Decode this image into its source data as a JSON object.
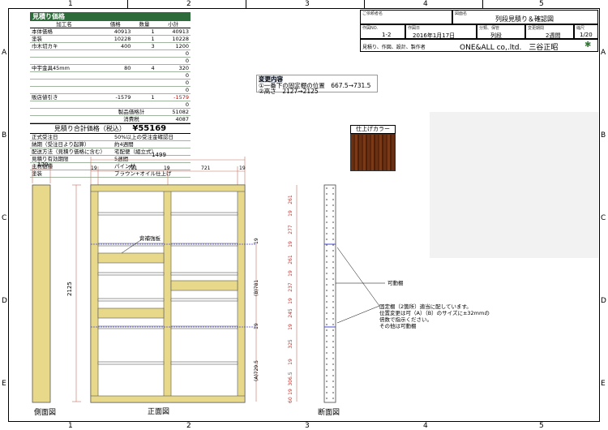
{
  "ruler": {
    "cols": [
      "1",
      "2",
      "3",
      "4",
      "5"
    ],
    "rows": [
      "A",
      "B",
      "C",
      "D",
      "E"
    ]
  },
  "estimate": {
    "title": "見積り価格",
    "headers": [
      "加工名",
      "価格",
      "数量",
      "小計"
    ],
    "rows": [
      {
        "name": "本体価格",
        "price": "40913",
        "qty": "1",
        "sub": "40913"
      },
      {
        "name": "塗装",
        "price": "10228",
        "qty": "1",
        "sub": "10228"
      },
      {
        "name": "巾木切カキ",
        "price": "400",
        "qty": "3",
        "sub": "1200"
      },
      {
        "name": "",
        "price": "",
        "qty": "",
        "sub": "0"
      },
      {
        "name": "",
        "price": "",
        "qty": "",
        "sub": "0"
      },
      {
        "name": "中宇金具45mm",
        "price": "80",
        "qty": "4",
        "sub": "320"
      },
      {
        "name": "",
        "price": "",
        "qty": "",
        "sub": "0"
      },
      {
        "name": "",
        "price": "",
        "qty": "",
        "sub": "0"
      },
      {
        "name": "",
        "price": "",
        "qty": "",
        "sub": "0"
      },
      {
        "name": "販店値引き",
        "price": "-1579",
        "qty": "1",
        "sub": "-1579"
      },
      {
        "name": "",
        "price": "",
        "qty": "",
        "sub": "0"
      }
    ],
    "product_total_label": "製品価格計",
    "product_total": "51082",
    "tax_label": "消費税",
    "tax": "4087",
    "grand_label": "見積り合計価格（税込）",
    "grand_total": "¥55169",
    "conditions": [
      {
        "k": "正式受注日",
        "v": "50%以上の受注金確認日"
      },
      {
        "k": "納期（受注日より起算）",
        "v": "約4週間"
      },
      {
        "k": "配送方法（見積り価格に含む）",
        "v": "宅配便（組立式）"
      },
      {
        "k": "見積り有効期限",
        "v": "5週間"
      },
      {
        "k": "主材樹種",
        "v": "パイン材"
      },
      {
        "k": "塗装",
        "v": "ブラウン+オイル仕上げ"
      }
    ]
  },
  "title_block": {
    "client_label": "ご依頼者名",
    "drawing_label": "図面名",
    "drawing_name": "列段見積り＆確認図",
    "no_label": "作図NO.",
    "no": "1-2",
    "date_label": "作図日",
    "date": "2016年1月17日",
    "category_label": "分類、保管",
    "category": "列段",
    "period_label": "変更期間",
    "period": "2週間",
    "scale_label": "縮尺",
    "scale": "1/20",
    "maker_label": "見積り、作図、設計、製作者",
    "maker": "ONE&ALL co,.ltd.　三谷正昭"
  },
  "changes": {
    "title": "変更内容",
    "line1": "①一番下の固定棚の位置　667.5→731.5",
    "line2": "②高さ　2127→2125"
  },
  "finish": {
    "label": "仕上げカラー"
  },
  "drawing": {
    "side_width": "170",
    "total_width": "1499",
    "widths": [
      "19",
      "721",
      "19",
      "721",
      "19"
    ],
    "height": "2125",
    "back_label": "背補強板",
    "movable_label": "可動棚",
    "fixed_note_1": "固定棚（2箇所）適当に配しています。",
    "fixed_note_2": "位置変更は可（A）（B）のサイズに±32mmの",
    "fixed_note_3": "倍数で指示ください。",
    "fixed_note_4": "その他は可動棚",
    "dim_B": "(B)781",
    "dim_A": "(A)729.5",
    "dim_19": "19",
    "section_dims": [
      "261",
      "19",
      "277",
      "19",
      "261",
      "19",
      "237",
      "19",
      "245",
      "19",
      "325",
      "19",
      "306.5",
      "19",
      "60"
    ]
  },
  "captions": {
    "side": "側面図",
    "front": "正面図",
    "section": "断面図"
  }
}
